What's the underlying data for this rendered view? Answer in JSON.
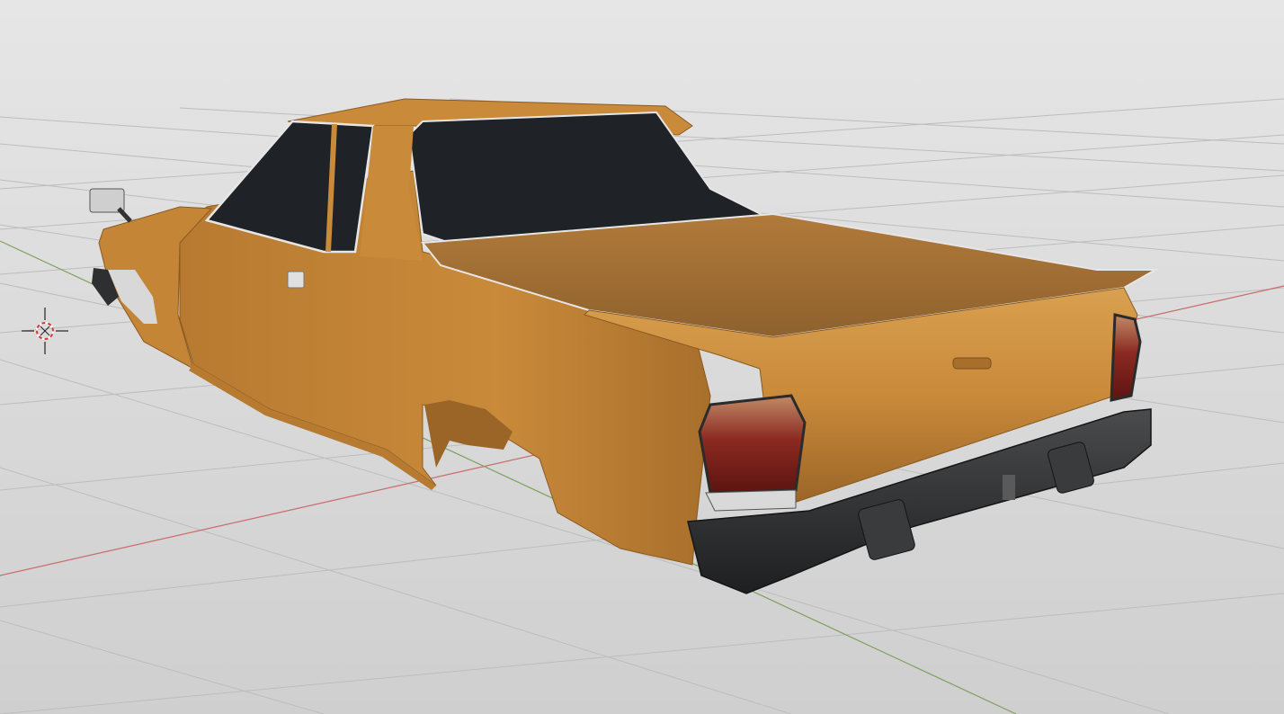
{
  "viewport": {
    "background_top": "#e6e6e6",
    "background_bottom": "#cfcfcf",
    "grid_color": "#bdbdbd",
    "x_axis_color": "#c96b6b",
    "y_axis_color": "#7fa15f"
  },
  "model": {
    "body_color": "#c98a3a",
    "body_shadow": "#8a5a22",
    "glass_color": "#1f2226",
    "trim_color": "#e6e6e6",
    "bumper_color": "#2e2f31",
    "taillight_color": "#8a1f1a"
  },
  "icons": {
    "origin": "3d-cursor-icon"
  }
}
